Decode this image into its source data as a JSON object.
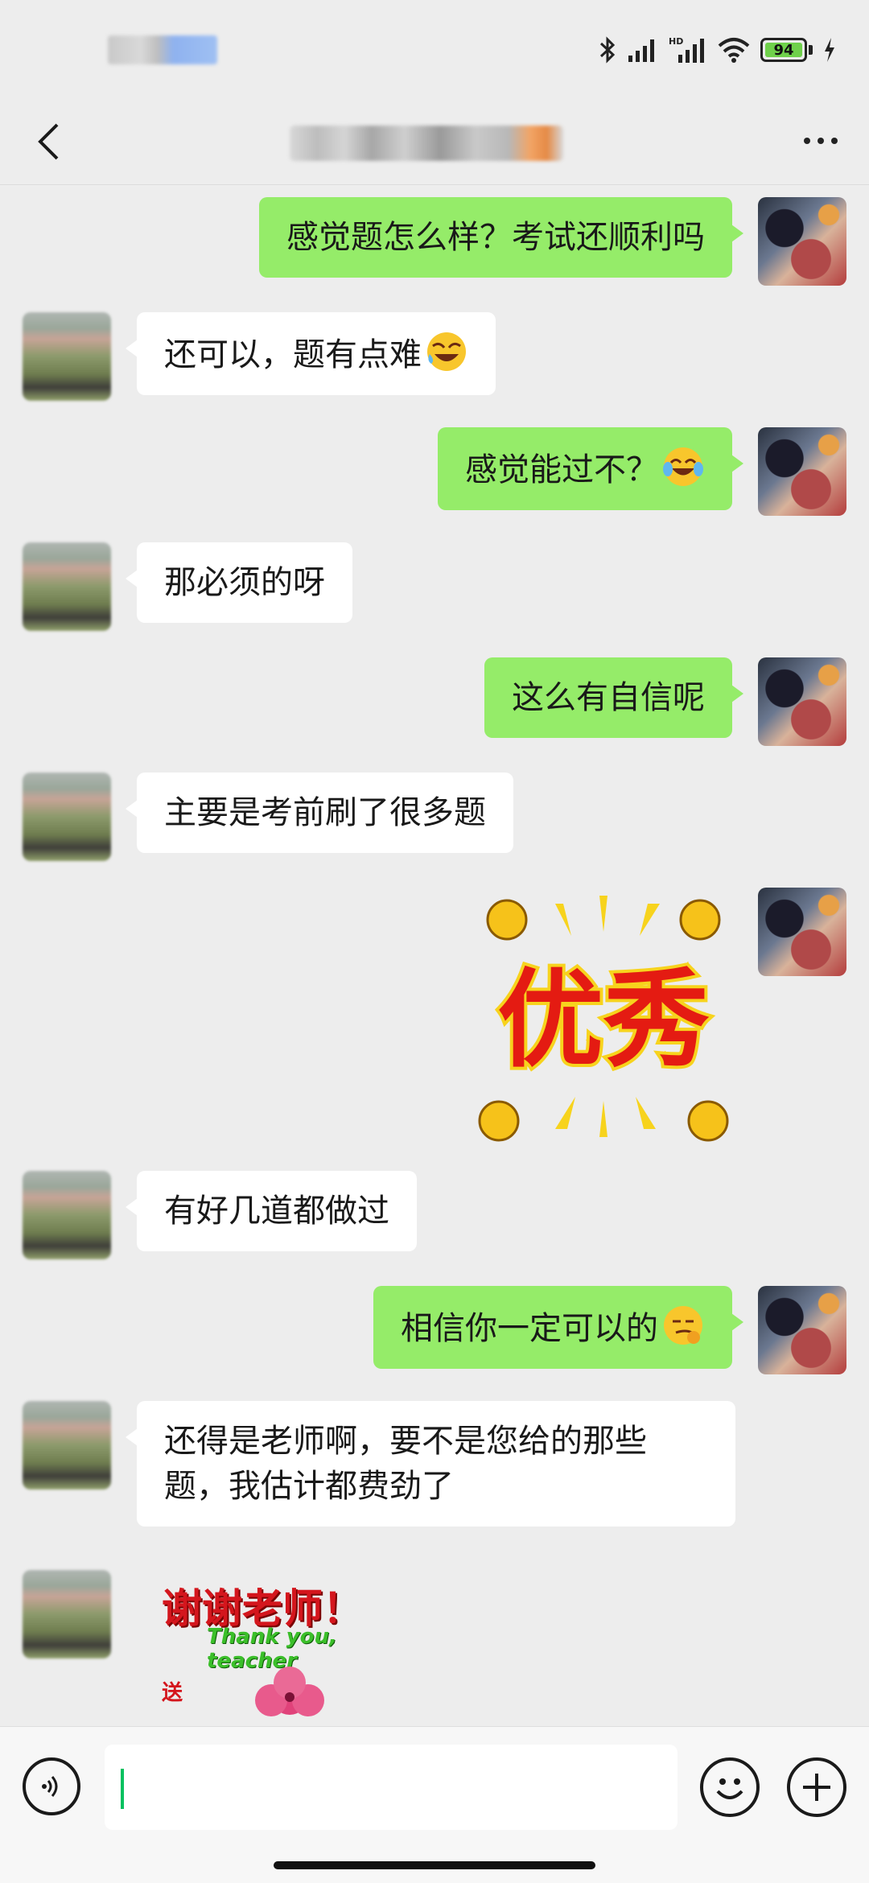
{
  "status_bar": {
    "battery": "94",
    "icons": [
      "bluetooth-icon",
      "signal-icon",
      "hd-signal-icon",
      "wifi-icon",
      "battery-icon",
      "charging-icon"
    ]
  },
  "header": {
    "back_icon": "chevron-left-icon",
    "more_icon": "more-dots-icon"
  },
  "messages": [
    {
      "side": "right",
      "text": "感觉题怎么样？考试还顺利吗"
    },
    {
      "side": "left",
      "text": "还可以，题有点难",
      "emoji": "laughing-sweat-emoji"
    },
    {
      "side": "right",
      "text": "感觉能过不？",
      "emoji": "tears-of-joy-emoji"
    },
    {
      "side": "left",
      "text": "那必须的呀"
    },
    {
      "side": "right",
      "text": "这么有自信呢"
    },
    {
      "side": "left",
      "text": "主要是考前刷了很多题"
    },
    {
      "side": "right",
      "sticker": "优秀"
    },
    {
      "side": "left",
      "text": "有好几道都做过"
    },
    {
      "side": "right",
      "text": "相信你一定可以的",
      "emoji": "smirk-emoji"
    },
    {
      "side": "left",
      "text": "还得是老师啊，要不是您给的那些题，我估计都费劲了"
    },
    {
      "side": "left",
      "sticker_title": "谢谢老师！",
      "sticker_sub": "Thank you, teacher",
      "sticker_small": "送"
    }
  ],
  "input_bar": {
    "voice_icon": "voice-icon",
    "emoji_icon": "emoji-icon",
    "plus_icon": "plus-icon"
  },
  "colors": {
    "background": "#ededed",
    "outgoing_bubble": "#95ec69",
    "incoming_bubble": "#ffffff",
    "caret": "#07c160"
  }
}
